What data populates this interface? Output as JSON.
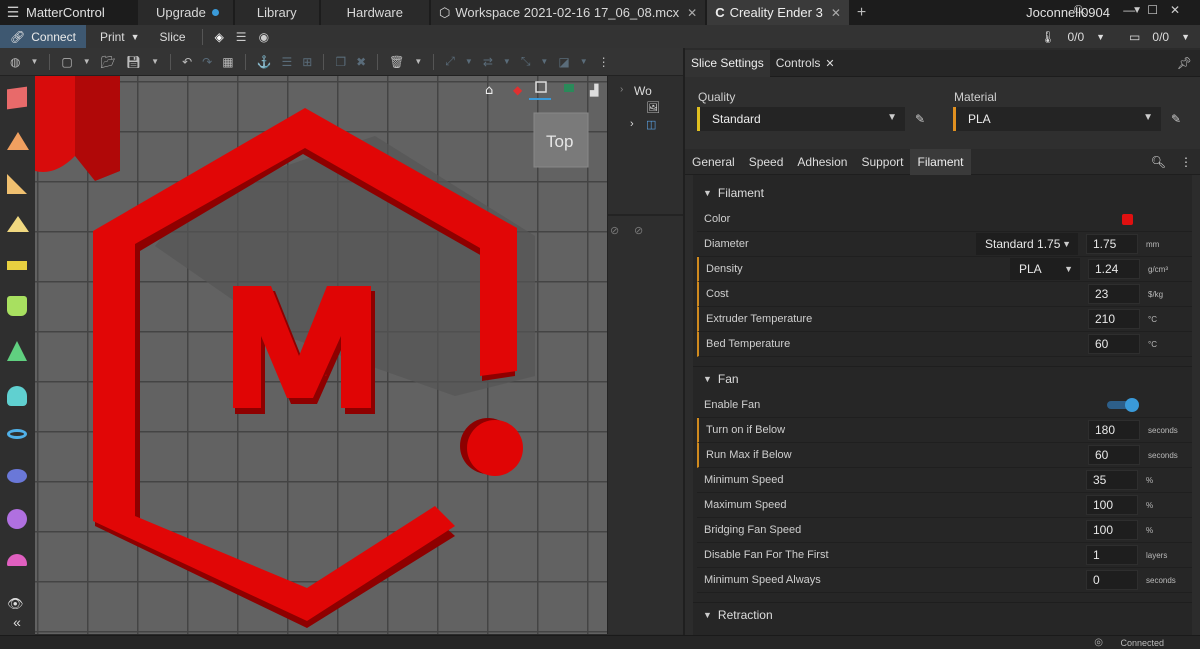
{
  "titlebar": {
    "app_name": "MatterControl",
    "tabs": [
      {
        "label": "Upgrade",
        "dot": true
      },
      {
        "label": "Library"
      },
      {
        "label": "Hardware"
      },
      {
        "label": "Workspace 2021-02-16 17_06_08.mcx",
        "closable": true
      },
      {
        "label": "Creality Ender 3",
        "closable": true
      }
    ],
    "username": "Joconnell0904"
  },
  "toolbar": {
    "connect": "Connect",
    "print": "Print",
    "slice": "Slice",
    "counter1": "0/0",
    "counter2": "0/0"
  },
  "viewport": {
    "view_cube_label": "Top",
    "logo_letter": "M"
  },
  "tree": {
    "label": "Wo"
  },
  "panel": {
    "tabs": {
      "slice_settings": "Slice Settings",
      "controls": "Controls"
    },
    "quality_label": "Quality",
    "quality_value": "Standard",
    "material_label": "Material",
    "material_value": "PLA",
    "category_tabs": [
      "General",
      "Speed",
      "Adhesion",
      "Support",
      "Filament"
    ],
    "active_category": "Filament",
    "accent_color": "#d08a1e",
    "filament": {
      "title": "Filament",
      "color_label": "Color",
      "color_value": "#e01010",
      "diameter_label": "Diameter",
      "diameter_preset": "Standard 1.75",
      "diameter_value": "1.75",
      "diameter_unit": "mm",
      "density_label": "Density",
      "density_preset": "PLA",
      "density_value": "1.24",
      "density_unit": "g/cm³",
      "cost_label": "Cost",
      "cost_value": "23",
      "cost_unit": "$/kg",
      "extruder_label": "Extruder Temperature",
      "extruder_value": "210",
      "extruder_unit": "°C",
      "bed_label": "Bed Temperature",
      "bed_value": "60",
      "bed_unit": "°C"
    },
    "fan": {
      "title": "Fan",
      "enable_label": "Enable Fan",
      "enable_value": true,
      "rows": [
        {
          "label": "Turn on if Below",
          "value": "180",
          "unit": "seconds",
          "mark": true
        },
        {
          "label": "Run Max if Below",
          "value": "60",
          "unit": "seconds",
          "mark": true
        },
        {
          "label": "Minimum Speed",
          "value": "35",
          "unit": "%"
        },
        {
          "label": "Maximum Speed",
          "value": "100",
          "unit": "%"
        },
        {
          "label": "Bridging Fan Speed",
          "value": "100",
          "unit": "%"
        },
        {
          "label": "Disable Fan For The First",
          "value": "1",
          "unit": "layers"
        },
        {
          "label": "Minimum Speed Always",
          "value": "0",
          "unit": "seconds"
        }
      ]
    },
    "retraction": {
      "title": "Retraction"
    }
  },
  "status": {
    "connection": "Connected"
  }
}
